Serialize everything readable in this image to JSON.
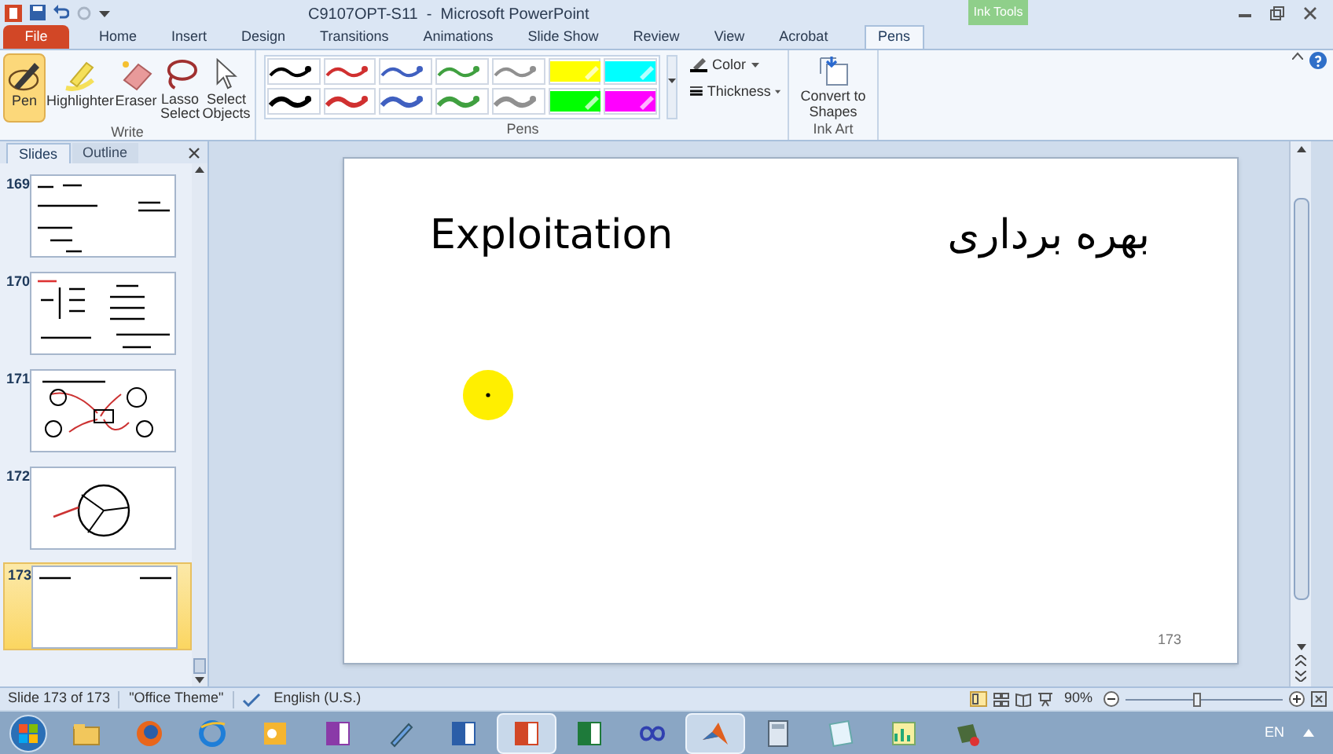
{
  "window": {
    "title": "C9107OPT-S11  -  Microsoft PowerPoint",
    "contextual_tab": "Ink Tools"
  },
  "tabs": [
    {
      "label": "File",
      "kind": "file",
      "selected": false
    },
    {
      "label": "Home",
      "kind": "tab",
      "selected": false
    },
    {
      "label": "Insert",
      "kind": "tab",
      "selected": false
    },
    {
      "label": "Design",
      "kind": "tab",
      "selected": false
    },
    {
      "label": "Transitions",
      "kind": "tab",
      "selected": false
    },
    {
      "label": "Animations",
      "kind": "tab",
      "selected": false
    },
    {
      "label": "Slide Show",
      "kind": "tab",
      "selected": false
    },
    {
      "label": "Review",
      "kind": "tab",
      "selected": false
    },
    {
      "label": "View",
      "kind": "tab",
      "selected": false
    },
    {
      "label": "Acrobat",
      "kind": "tab",
      "selected": false
    },
    {
      "label": "Pens",
      "kind": "contextual",
      "selected": true
    }
  ],
  "write_group": {
    "label": "Write",
    "tools": [
      {
        "label": "Pen",
        "kind": "pen",
        "selected": true
      },
      {
        "label": "Highlighter",
        "kind": "highlighter",
        "selected": false
      },
      {
        "label": "Eraser",
        "kind": "eraser",
        "selected": false
      },
      {
        "label": "Lasso Select",
        "kind": "lasso",
        "selected": false
      },
      {
        "label": "Select Objects",
        "kind": "select",
        "selected": false
      }
    ]
  },
  "pens_group": {
    "label": "Pens",
    "color_button": "Color",
    "thickness_button": "Thickness",
    "pens": [
      {
        "kind": "pen",
        "color": "#000000"
      },
      {
        "kind": "pen",
        "color": "#d03030"
      },
      {
        "kind": "pen",
        "color": "#4060c0"
      },
      {
        "kind": "pen",
        "color": "#40a040"
      },
      {
        "kind": "pen",
        "color": "#909090"
      },
      {
        "kind": "highlighter",
        "color": "#ffff00"
      },
      {
        "kind": "highlighter",
        "color": "#00ffff"
      },
      {
        "kind": "pen",
        "color": "#000000"
      },
      {
        "kind": "pen",
        "color": "#d03030"
      },
      {
        "kind": "pen",
        "color": "#4060c0"
      },
      {
        "kind": "pen",
        "color": "#40a040"
      },
      {
        "kind": "pen",
        "color": "#909090"
      },
      {
        "kind": "highlighter",
        "color": "#00ff00"
      },
      {
        "kind": "highlighter",
        "color": "#ff00ff"
      }
    ]
  },
  "ink_art_group": {
    "label": "Ink Art",
    "button": "Convert to Shapes"
  },
  "pane_tabs": [
    {
      "label": "Slides",
      "selected": true
    },
    {
      "label": "Outline",
      "selected": false
    }
  ],
  "thumbnails": [
    {
      "number": "169",
      "selected": false
    },
    {
      "number": "170",
      "selected": false
    },
    {
      "number": "171",
      "selected": false
    },
    {
      "number": "172",
      "selected": false
    },
    {
      "number": "173",
      "selected": true
    }
  ],
  "slide": {
    "heading": "Exploitation",
    "heading_translation": "بهره برداری",
    "number": "173"
  },
  "status_bar": {
    "slide_count": "Slide 173 of 173",
    "theme": "\"Office Theme\"",
    "language": "English (U.S.)",
    "zoom": "90%",
    "zoom_slider": {
      "level": 0.45
    }
  },
  "taskbar": {
    "apps": [
      {
        "kind": "folder",
        "active": false
      },
      {
        "kind": "firefox",
        "active": false
      },
      {
        "kind": "ie",
        "active": false
      },
      {
        "kind": "outlook",
        "active": false
      },
      {
        "kind": "onenote",
        "active": false
      },
      {
        "kind": "pen",
        "active": false
      },
      {
        "kind": "word",
        "active": false
      },
      {
        "kind": "powerpoint",
        "active": true
      },
      {
        "kind": "excel",
        "active": false
      },
      {
        "kind": "infinity",
        "active": false
      },
      {
        "kind": "matlab",
        "active": true
      },
      {
        "kind": "calculator",
        "active": false
      },
      {
        "kind": "notepad",
        "active": false
      },
      {
        "kind": "chart",
        "active": false
      },
      {
        "kind": "tool",
        "active": false
      }
    ],
    "language": "EN"
  }
}
